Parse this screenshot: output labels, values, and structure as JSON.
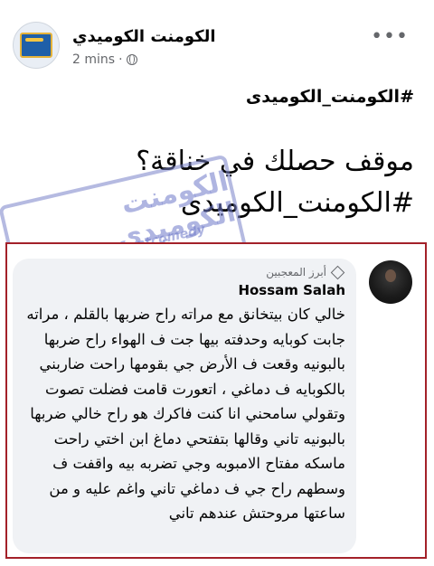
{
  "post": {
    "page_name": "الكومنت الكوميدي",
    "time": "2 mins",
    "separator": "·",
    "more_label": "•••",
    "hashtag": "#الكومنت_الكوميدى",
    "headline": "موقف حصلك في خناقة؟\n#الكومنت_الكوميدى"
  },
  "comment": {
    "badge": "أبرز المعجبين",
    "author": "Hossam Salah",
    "text": "خالي كان بيتخانق مع مراته راح ضربها بالقلم ، مراته جابت كوبايه وحدفته بيها جت ف الهواء راح ضربها بالبونيه وقعت ف الأرض جي بقومها راحت ضاربني بالكوبايه ف دماغي ، اتعورت قامت فضلت تصوت وتقولي سامحني انا كنت فاكرك هو راح خالي ضربها بالبونيه تاني وقالها بتفتحي دماغ ابن اختي راحت ماسكه مفتاح الامبوبه وجي تضربه بيه واقفت ف وسطهم راح جي ف دماغي تاني واغم عليه و من ساعتها مروحتش عندهم تاني"
  },
  "watermark": {
    "main": "الكومنت الكوميدي",
    "sub": "FB.COM/Commentcomedy"
  },
  "colors": {
    "frame": "#a32129",
    "bubble": "#f0f2f5",
    "muted": "#65676b"
  }
}
